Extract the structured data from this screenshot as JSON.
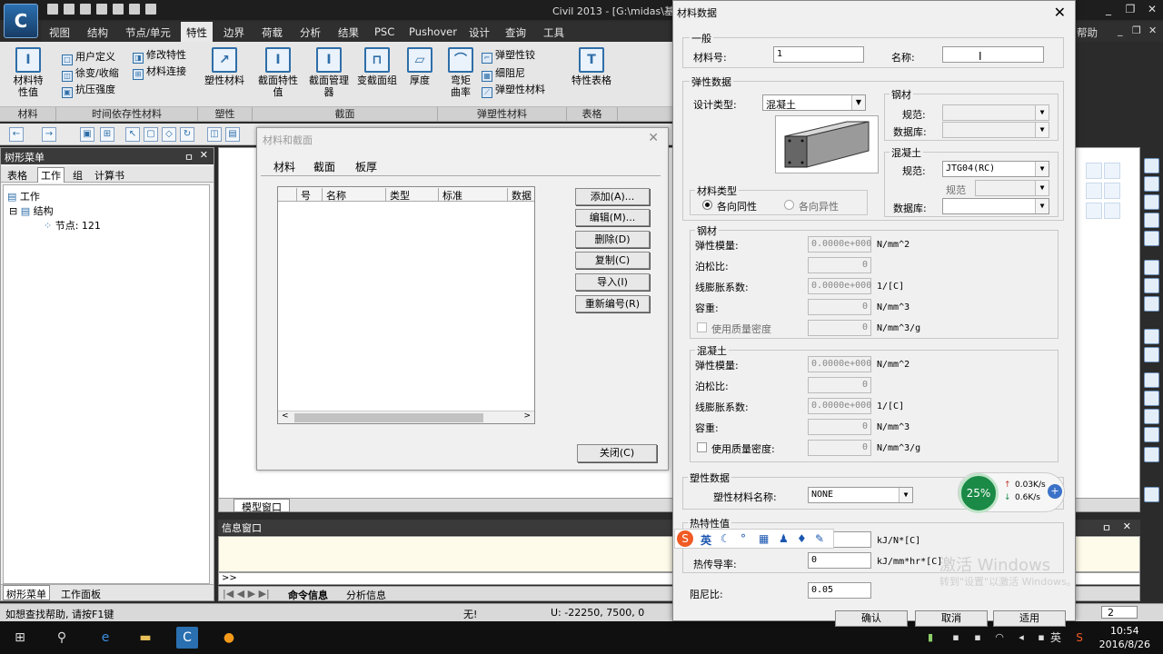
{
  "app": {
    "title": "Civil 2013 - [G:\\midas\\基",
    "logo_text": "C",
    "window_controls": [
      "_",
      "❐",
      "✕"
    ],
    "help_label": "帮助",
    "help_controls": [
      "_",
      "❐",
      "✕"
    ]
  },
  "menu": [
    "视图",
    "结构",
    "节点/单元",
    "特性",
    "边界",
    "荷载",
    "分析",
    "结果",
    "PSC",
    "Pushover",
    "设计",
    "查询",
    "工具"
  ],
  "menu_active": "特性",
  "ribbon": {
    "material_props": "材料特性值",
    "user_defined": "用户定义",
    "creep_shrink": "徐变/收缩",
    "compressive_strength": "抗压强度",
    "modify_props": "修改特性",
    "material_link": "材料连接",
    "plastic_material": "塑性材料",
    "section_props": "截面特性值",
    "section_manager": "截面管理器",
    "tapered_group": "变截面组",
    "thickness": "厚度",
    "moment_curvature": "弯矩曲率",
    "elastoplastic_hinge": "弹塑性铰",
    "fiber_damping": "细阻尼",
    "elastoplastic_material": "弹塑性材料",
    "property_table": "特性表格",
    "groups": [
      "材料",
      "时间依存性材料",
      "塑性",
      "截面",
      "弹塑性材料",
      "表格"
    ]
  },
  "tree": {
    "title": "树形菜单",
    "pin": "ㅁ",
    "close": "✕",
    "tabs": [
      "表格",
      "工作",
      "组",
      "计算书"
    ],
    "active_tab": "工作",
    "items": [
      "工作",
      "结构",
      "节点: 121"
    ],
    "footer_tabs": [
      "树形菜单",
      "工作面板"
    ]
  },
  "model_tab": "模型窗口",
  "info": {
    "title": "信息窗口",
    "controls": [
      "ㅁ",
      "✕"
    ],
    "prompt": ">>",
    "tabs": [
      "命令信息",
      "分析信息"
    ]
  },
  "status": {
    "help": "如想查找帮助, 请按F1键",
    "none": "无!",
    "coords": "U: -22250, 7500, 0",
    "page": "2"
  },
  "clock": {
    "time": "10:54",
    "date": "2016/8/26",
    "ime": "英"
  },
  "mat_dialog": {
    "title": "材料和截面",
    "close": "✕",
    "tabs": [
      "材料",
      "截面",
      "板厚"
    ],
    "columns": [
      "号",
      "名称",
      "类型",
      "标准",
      "数据"
    ],
    "buttons": [
      "添加(A)...",
      "编辑(M)...",
      "删除(D)",
      "复制(C)",
      "导入(I)",
      "重新编号(R)"
    ],
    "close_button": "关闭(C)"
  },
  "data_dialog": {
    "title": "材料数据",
    "close": "✕",
    "general": {
      "group": "一般",
      "id_label": "材料号:",
      "id_value": "1",
      "name_label": "名称:",
      "name_value": ""
    },
    "elastic": {
      "group": "弹性数据",
      "design_type_label": "设计类型:",
      "design_type_value": "混凝土"
    },
    "steel_box": {
      "group": "钢材",
      "spec_label": "规范:",
      "db_label": "数据库:"
    },
    "concrete_box": {
      "group": "混凝土",
      "spec_label": "规范:",
      "spec_value": "JTG04(RC)",
      "code_label": "规范",
      "db_label": "数据库:"
    },
    "material_type": {
      "group": "材料类型",
      "iso": "各向同性",
      "aniso": "各向异性"
    },
    "steel": {
      "group": "钢材",
      "rows": [
        {
          "label": "弹性模量:",
          "value": "0.0000e+000",
          "unit": "N/mm^2"
        },
        {
          "label": "泊松比:",
          "value": "0",
          "unit": ""
        },
        {
          "label": "线膨胀系数:",
          "value": "0.0000e+000",
          "unit": "1/[C]"
        },
        {
          "label": "容重:",
          "value": "0",
          "unit": "N/mm^3"
        },
        {
          "label": "使用质量密度",
          "value": "0",
          "unit": "N/mm^3/g"
        }
      ]
    },
    "concrete": {
      "group": "混凝土",
      "rows": [
        {
          "label": "弹性模量:",
          "value": "0.0000e+000",
          "unit": "N/mm^2"
        },
        {
          "label": "泊松比:",
          "value": "0",
          "unit": ""
        },
        {
          "label": "线膨胀系数:",
          "value": "0.0000e+000",
          "unit": "1/[C]"
        },
        {
          "label": "容重:",
          "value": "0",
          "unit": "N/mm^3"
        },
        {
          "label": "使用质量密度:",
          "value": "0",
          "unit": "N/mm^3/g"
        }
      ]
    },
    "plastic": {
      "group": "塑性数据",
      "label": "塑性材料名称:",
      "value": "NONE"
    },
    "thermal": {
      "group": "热特性值",
      "specific_heat_unit": "kJ/N*[C]",
      "conductivity_label": "热传导率:",
      "conductivity_value": "0",
      "conductivity_unit": "kJ/mm*hr*[C]"
    },
    "damping": {
      "label": "阻尼比:",
      "value": "0.05"
    },
    "buttons": [
      "确认",
      "取消",
      "适用"
    ]
  },
  "speed": {
    "percent": "25%",
    "up": "0.03K/s",
    "down": "0.6K/s"
  },
  "ime_toolbar": {
    "logo": "S",
    "lang": "英"
  },
  "watermark": {
    "line1": "激活 Windows",
    "line2": "转到\"设置\"以激活 Windows。"
  }
}
